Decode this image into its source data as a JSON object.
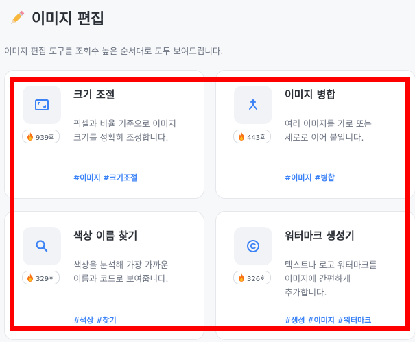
{
  "page": {
    "title": "이미지 편집",
    "subtitle": "이미지 편집 도구를 조회수 높은 순서대로 모두 보여드립니다."
  },
  "colors": {
    "accent": "#3b82f6",
    "highlight": "#ff0000"
  },
  "tools": [
    {
      "title": "크기 조절",
      "desc_lines": [
        "픽셀과 비율 기준으로 이미지",
        "크기를 정확히 조정합니다."
      ],
      "views": "939회",
      "tags": "#이미지 #크기조절",
      "icon": "resize-icon"
    },
    {
      "title": "이미지 병합",
      "desc_lines": [
        "여러 이미지를 가로 또는",
        "세로로 이어 붙입니다."
      ],
      "views": "443회",
      "tags": "#이미지 #병합",
      "icon": "merge-icon"
    },
    {
      "title": "색상 이름 찾기",
      "desc_lines": [
        "색상을 분석해 가장 가까운",
        "이름과 코드로 보여줍니다."
      ],
      "views": "329회",
      "tags": "#색상 #찾기",
      "icon": "search-icon"
    },
    {
      "title": "워터마크 생성기",
      "desc_lines": [
        "텍스트나 로고 워터마크를",
        "이미지에 간편하게",
        "추가합니다."
      ],
      "views": "326회",
      "tags": "#생성 #이미지 #워터마크",
      "icon": "copyright-icon"
    }
  ]
}
